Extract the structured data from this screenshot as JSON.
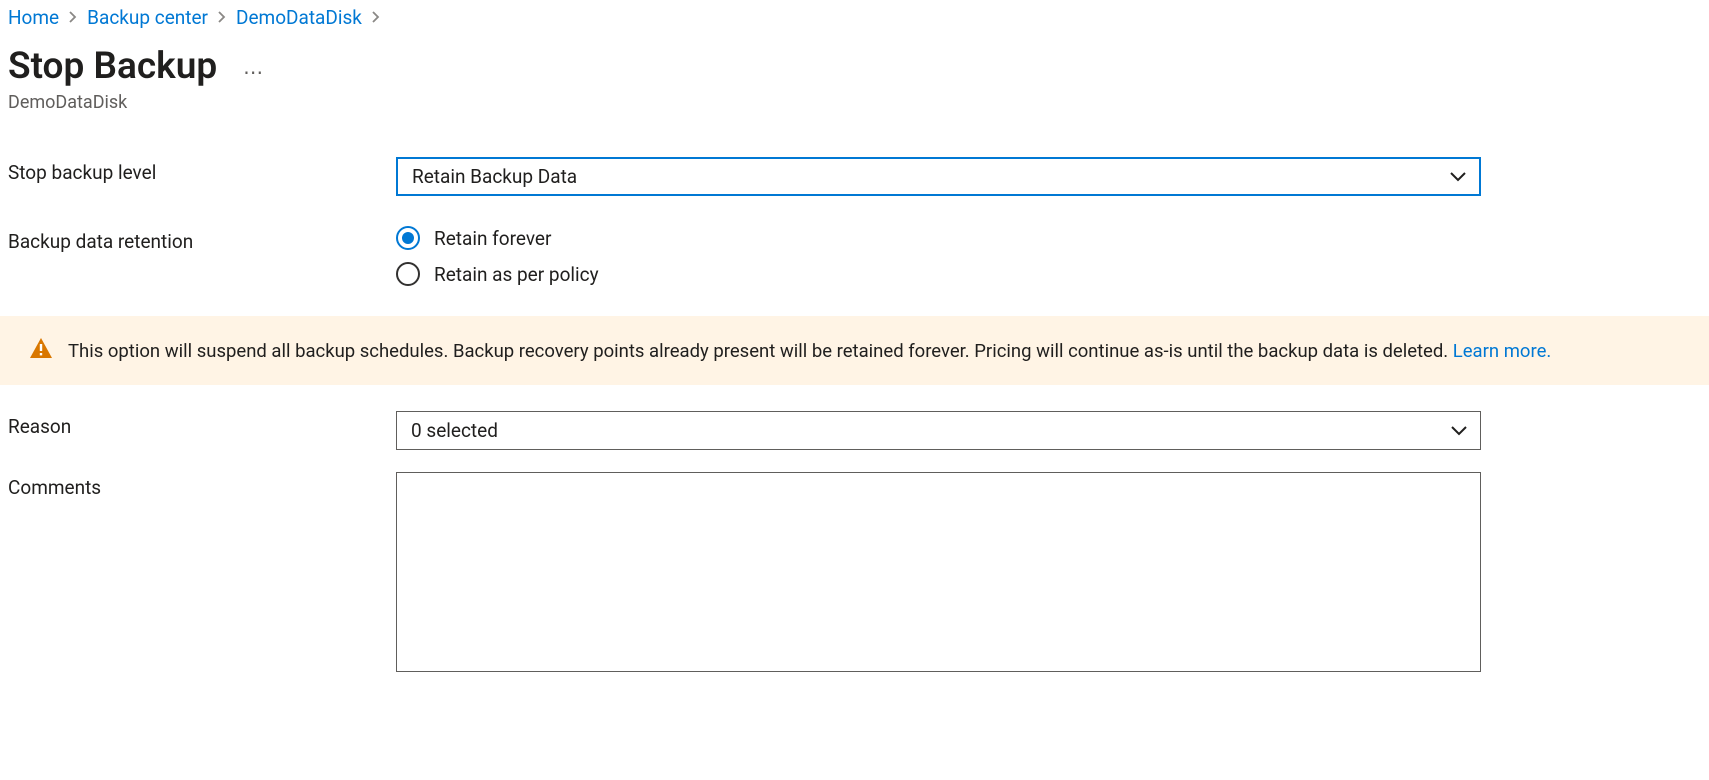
{
  "breadcrumbs": {
    "items": [
      "Home",
      "Backup center",
      "DemoDataDisk"
    ]
  },
  "header": {
    "title": "Stop Backup",
    "resource_name": "DemoDataDisk"
  },
  "form": {
    "stop_level_label": "Stop backup level",
    "stop_level_value": "Retain Backup Data",
    "retention_label": "Backup data retention",
    "retention_options": {
      "opt1": "Retain forever",
      "opt2": "Retain as per policy"
    },
    "reason_label": "Reason",
    "reason_value": "0 selected",
    "comments_label": "Comments",
    "comments_value": ""
  },
  "info": {
    "message": "This option will suspend all backup schedules. Backup recovery points already present will be retained forever. Pricing will continue as-is until the backup data is deleted. ",
    "link_text": "Learn more."
  }
}
